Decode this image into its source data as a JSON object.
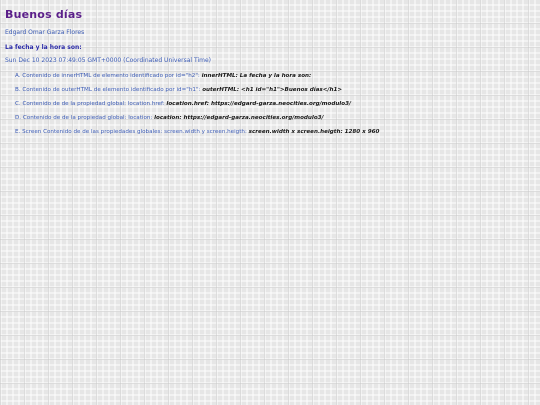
{
  "title": "Buenos días",
  "author": "Edgard Omar Garza Flores",
  "subtitle": "La fecha y la hora son:",
  "datetime": "Sun Dec 10 2023 07:49:05 GMT+0000 (Coordinated Universal Time)",
  "items": [
    {
      "label": "A. Contenido de innerHTML de elemento identificado por id=\"h2\":",
      "result": "innerHTML: La fecha y la hora son:"
    },
    {
      "label": "B. Contenido de outerHTML de elemento identificado por id=\"h1\":",
      "result": "outerHTML: <h1 id=\"h1\">Buenos días</h1>"
    },
    {
      "label": "C. Contenido de de la propiedad global: location.href:",
      "result": "location.href: https://edgard-garza.neocities.org/modulo3/"
    },
    {
      "label": "D. Contenido de de la propiedad global: location:",
      "result": "location: https://edgard-garza.neocities.org/modulo3/"
    },
    {
      "label": "E. Screen Contenido de de las propiedades globales: screen.width y screen.heigth:",
      "result": "screen.width x screen.heigth: 1280 x 960"
    }
  ]
}
